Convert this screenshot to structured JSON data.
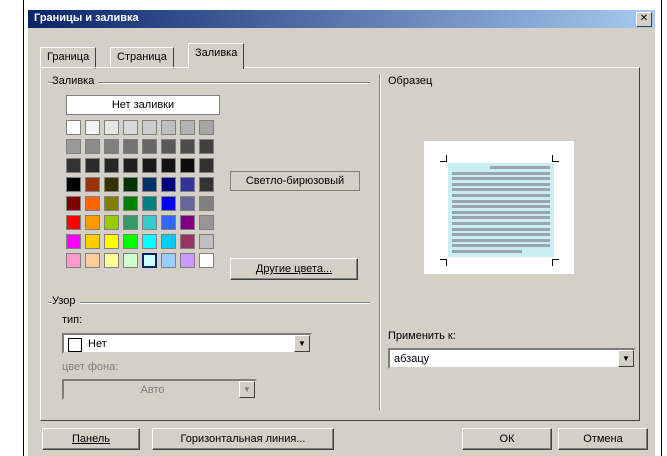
{
  "window": {
    "title": "Границы и заливка",
    "close_icon": "close-icon"
  },
  "tabs": [
    {
      "label": "Граница",
      "active": false
    },
    {
      "label": "Страница",
      "active": false
    },
    {
      "label": "Заливка",
      "active": true
    }
  ],
  "fill": {
    "group_label": "Заливка",
    "no_fill_label": "Нет заливки",
    "selected_color_name": "Светло-бирюзовый",
    "more_colors_button": "Другие цвета...",
    "palette_rows": [
      [
        "#ffffff",
        "#f2f2f2",
        "#e6e6e6",
        "#d9d9d9",
        "#cccccc",
        "#bfbfbf",
        "#b3b3b3",
        "#a6a6a6"
      ],
      [
        "#999999",
        "#8c8c8c",
        "#808080",
        "#737373",
        "#666666",
        "#595959",
        "#4d4d4d",
        "#404040"
      ],
      [
        "#333333",
        "#2b2b2b",
        "#262626",
        "#1f1f1f",
        "#1a1a1a",
        "#141414",
        "#0d0d0d",
        "#303030"
      ],
      [
        "#000000",
        "#993300",
        "#333300",
        "#003300",
        "#003366",
        "#000080",
        "#333399",
        "#333333"
      ],
      [
        "#800000",
        "#ff6600",
        "#808000",
        "#008000",
        "#008080",
        "#0000ff",
        "#666699",
        "#808080"
      ],
      [
        "#ff0000",
        "#ff9900",
        "#99cc00",
        "#339966",
        "#33cccc",
        "#3366ff",
        "#800080",
        "#969696"
      ],
      [
        "#ff00ff",
        "#ffcc00",
        "#ffff00",
        "#00ff00",
        "#00ffff",
        "#00ccff",
        "#993366",
        "#c0c0c0"
      ],
      [
        "#ff99cc",
        "#ffcc99",
        "#ffff99",
        "#ccffcc",
        "#ccffff",
        "#99ccff",
        "#cc99ff",
        "#ffffff"
      ]
    ],
    "selected": {
      "row": 7,
      "col": 4
    }
  },
  "pattern": {
    "group_label": "Узор",
    "type_label": "тип:",
    "type_value": "Нет",
    "bg_color_label": "цвет фона:",
    "bg_color_value": "Авто"
  },
  "sample": {
    "group_label": "Образец"
  },
  "apply_to": {
    "label": "Применить к:",
    "value": "абзацу"
  },
  "buttons": {
    "panel": "Панель",
    "horizontal_line": "Горизонтальная линия...",
    "ok": "ОК",
    "cancel": "Отмена"
  },
  "colors": {
    "title_start": "#0a246a",
    "title_end": "#a6caf0",
    "dialog_bg": "#d4d0c8",
    "preview_fill": "#c8eef4"
  }
}
